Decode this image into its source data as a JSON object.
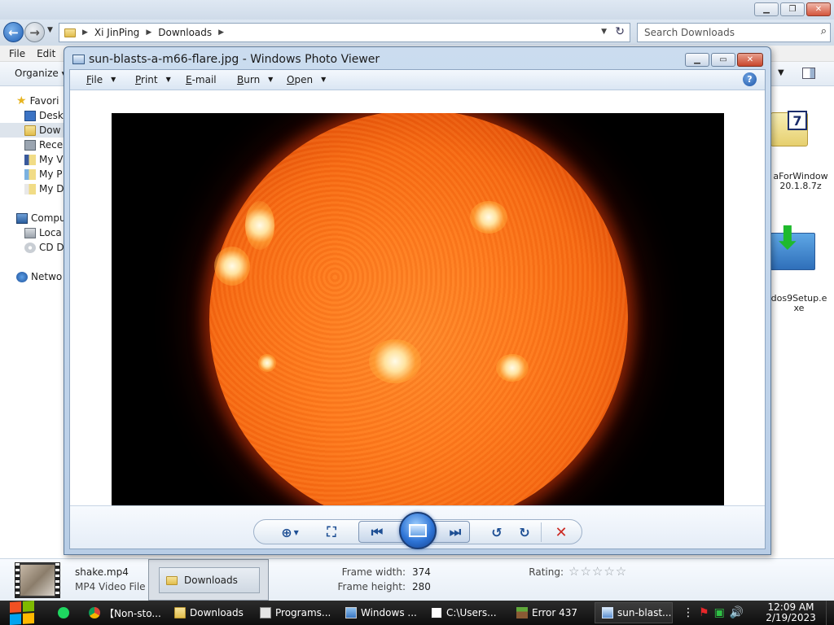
{
  "explorer": {
    "breadcrumb": [
      "Xi JinPing",
      "Downloads"
    ],
    "search_placeholder": "Search Downloads",
    "menu": [
      "File",
      "Edit"
    ],
    "organize": "Organize",
    "nav_items": [
      {
        "label": "Favori",
        "icon": "star-icon"
      },
      {
        "label": "Desk",
        "icon": "desktop-icon"
      },
      {
        "label": "Dow",
        "icon": "downloads-folder-icon"
      },
      {
        "label": "Rece",
        "icon": "recent-places-icon"
      },
      {
        "label": "My V",
        "icon": "videos-icon"
      },
      {
        "label": "My P",
        "icon": "pictures-icon"
      },
      {
        "label": "My D",
        "icon": "documents-icon"
      },
      {
        "label": "Compu",
        "icon": "computer-icon"
      },
      {
        "label": "Loca",
        "icon": "local-disk-icon"
      },
      {
        "label": "CD D",
        "icon": "cd-drive-icon"
      },
      {
        "label": "Netwo",
        "icon": "network-icon"
      }
    ],
    "files": [
      {
        "label_line1": "aForWindow",
        "label_line2": "20.1.8.7z"
      },
      {
        "label_line1": "dos9Setup.e",
        "label_line2": "xe"
      }
    ],
    "details": {
      "name": "shake.mp4",
      "type": "MP4 Video File (",
      "frame_width_label": "Frame width:",
      "frame_width": "374",
      "frame_height_label": "Frame height:",
      "frame_height": "280",
      "rating_label": "Rating:",
      "rating_stars": "☆☆☆☆☆",
      "rating": 0
    },
    "tooltip_label": "Downloads"
  },
  "viewer": {
    "title": "sun-blasts-a-m66-flare.jpg - Windows Photo Viewer",
    "menu": [
      {
        "accel": "F",
        "rest": "ile"
      },
      {
        "accel": "P",
        "rest": "rint"
      },
      {
        "accel": "E",
        "rest": "-mail"
      },
      {
        "accel": "B",
        "rest": "urn"
      },
      {
        "accel": "O",
        "rest": "pen"
      }
    ],
    "help_glyph": "?"
  },
  "taskbar": {
    "tasks": [
      {
        "label": "",
        "icon": "spotify-icon"
      },
      {
        "label": "【Non-sto...",
        "icon": "chrome-icon"
      },
      {
        "label": "Downloads",
        "icon": "folder-icon"
      },
      {
        "label": "Programs...",
        "icon": "document-icon"
      },
      {
        "label": "Windows ...",
        "icon": "window-icon"
      },
      {
        "label": "C:\\Users...",
        "icon": "7zip-icon"
      },
      {
        "label": "Error 437",
        "icon": "minecraft-icon"
      },
      {
        "label": "sun-blast...",
        "icon": "photo-viewer-icon"
      }
    ],
    "clock_time": "12:09 AM",
    "clock_date": "2/19/2023"
  }
}
